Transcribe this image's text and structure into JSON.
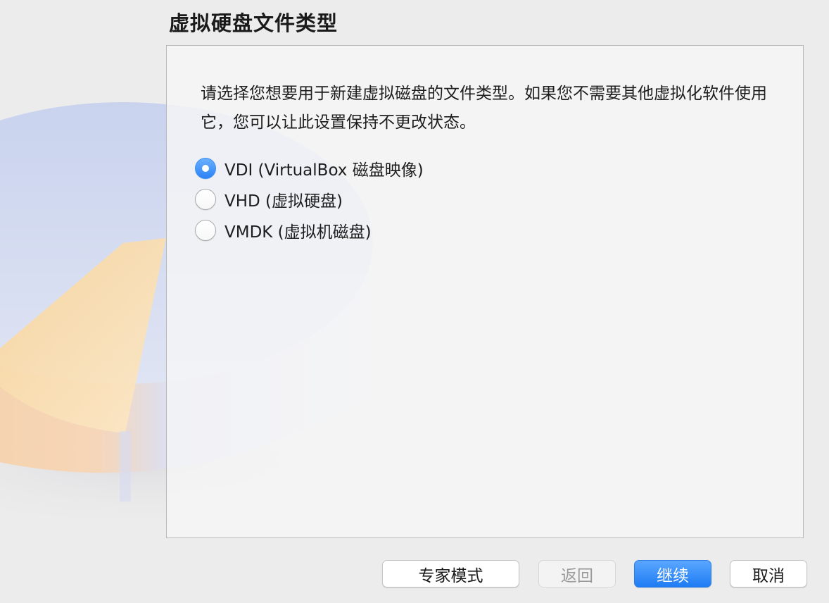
{
  "page": {
    "title": "虚拟硬盘文件类型",
    "description": "请选择您想要用于新建虚拟磁盘的文件类型。如果您不需要其他虚拟化软件使用它，您可以让此设置保持不更改状态。"
  },
  "options": [
    {
      "label": "VDI (VirtualBox 磁盘映像)",
      "checked": true
    },
    {
      "label": "VHD (虚拟硬盘)",
      "checked": false
    },
    {
      "label": "VMDK (虚拟机磁盘)",
      "checked": false
    }
  ],
  "buttons": {
    "expert_label": "专家模式",
    "back_label": "返回",
    "back_enabled": false,
    "continue_label": "继续",
    "cancel_label": "取消"
  },
  "colors": {
    "accent": "#2b83f6",
    "window_bg": "#ececec"
  },
  "icons": {
    "illustration": "disk-pie-icon"
  }
}
